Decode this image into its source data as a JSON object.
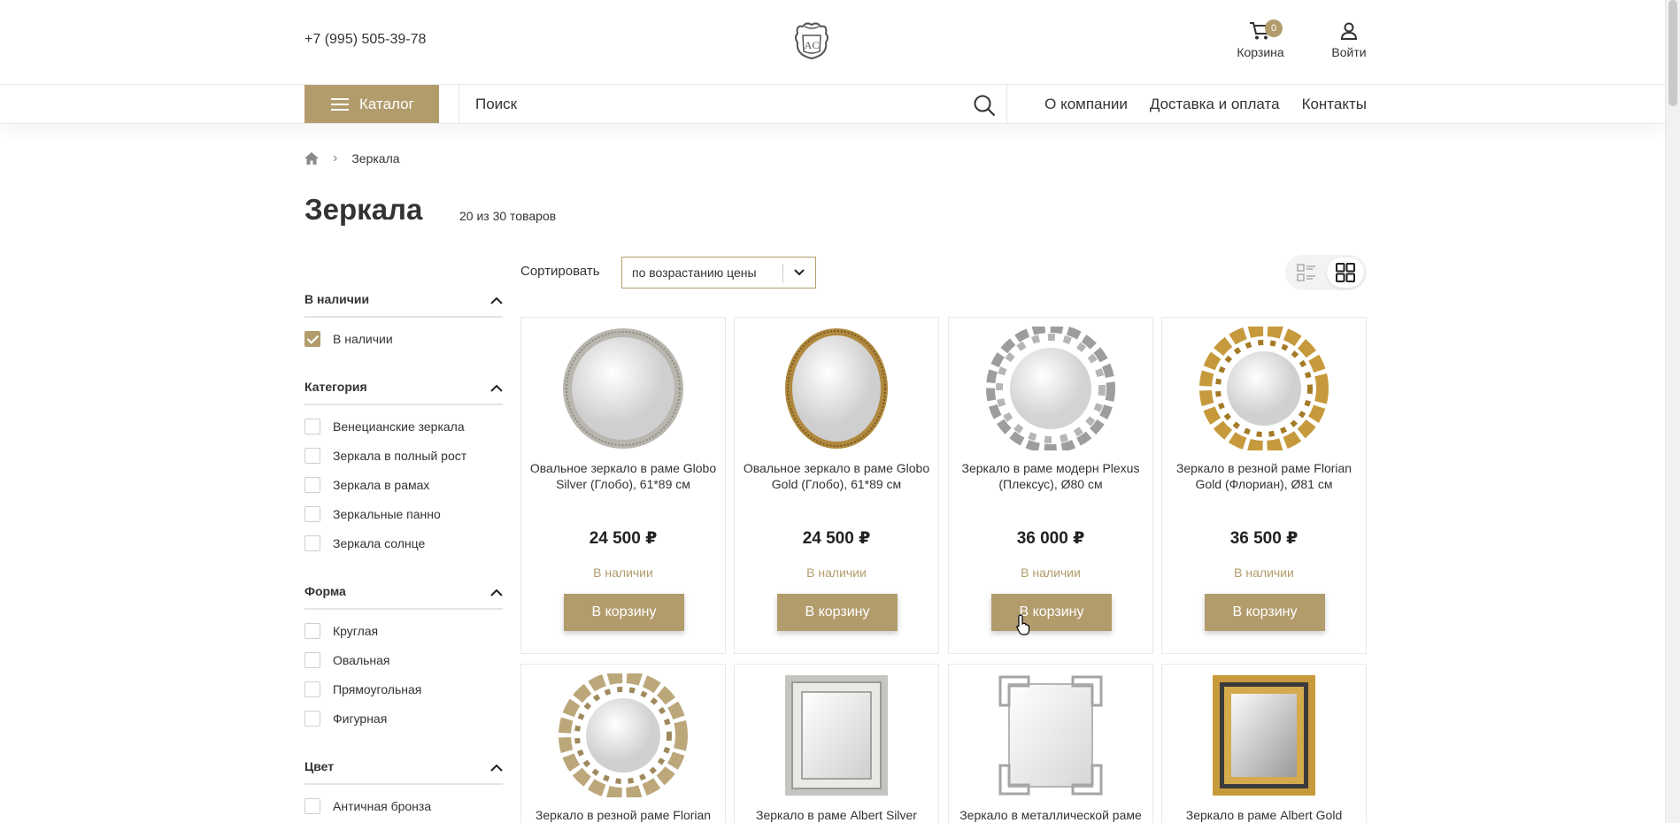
{
  "header": {
    "phone": "+7 (995) 505-39-78",
    "logo_text": "AC",
    "cart_label": "Корзина",
    "cart_count": "0",
    "login_label": "Войти"
  },
  "nav": {
    "catalog_label": "Каталог",
    "search_placeholder": "Поиск",
    "links": [
      "О компании",
      "Доставка и оплата",
      "Контакты"
    ]
  },
  "breadcrumb": {
    "current": "Зеркала"
  },
  "page": {
    "title": "Зеркала",
    "count": "20 из 30 товаров",
    "sort_label": "Сортировать",
    "sort_value": "по возрастанию цены"
  },
  "filters": [
    {
      "title": "В наличии",
      "options": [
        {
          "label": "В наличии",
          "checked": true
        }
      ]
    },
    {
      "title": "Категория",
      "options": [
        {
          "label": "Венецианские зеркала",
          "checked": false
        },
        {
          "label": "Зеркала в полный рост",
          "checked": false
        },
        {
          "label": "Зеркала в рамах",
          "checked": false
        },
        {
          "label": "Зеркальные панно",
          "checked": false
        },
        {
          "label": "Зеркала солнце",
          "checked": false
        }
      ]
    },
    {
      "title": "Форма",
      "options": [
        {
          "label": "Круглая",
          "checked": false
        },
        {
          "label": "Овальная",
          "checked": false
        },
        {
          "label": "Прямоугольная",
          "checked": false
        },
        {
          "label": "Фигурная",
          "checked": false
        }
      ]
    },
    {
      "title": "Цвет",
      "options": [
        {
          "label": "Античная бронза",
          "checked": false
        }
      ]
    }
  ],
  "products": [
    {
      "name": "Овальное зеркало в раме Globo Silver (Глобо), 61*89 см",
      "price": "24 500 ₽",
      "stock": "В наличии",
      "button": "В корзину",
      "image": "oval-silver"
    },
    {
      "name": "Овальное зеркало в раме Globo Gold (Глобо), 61*89 см",
      "price": "24 500 ₽",
      "stock": "В наличии",
      "button": "В корзину",
      "image": "oval-gold"
    },
    {
      "name": "Зеркало в раме модерн Plexus (Плексус), Ø80 см",
      "price": "36 000 ₽",
      "stock": "В наличии",
      "button": "В корзину",
      "image": "round-silver-ornate"
    },
    {
      "name": "Зеркало в резной раме Florian Gold (Флориан), Ø81 см",
      "price": "36 500 ₽",
      "stock": "В наличии",
      "button": "В корзину",
      "image": "round-gold-carved"
    },
    {
      "name": "Зеркало в резной раме Florian",
      "image": "round-champagne-carved"
    },
    {
      "name": "Зеркало в раме Albert Silver",
      "image": "rect-silver"
    },
    {
      "name": "Зеркало в металлической раме",
      "image": "rect-metal"
    },
    {
      "name": "Зеркало в раме Albert Gold",
      "image": "rect-gold"
    }
  ],
  "colors": {
    "accent": "#b29c6c"
  }
}
